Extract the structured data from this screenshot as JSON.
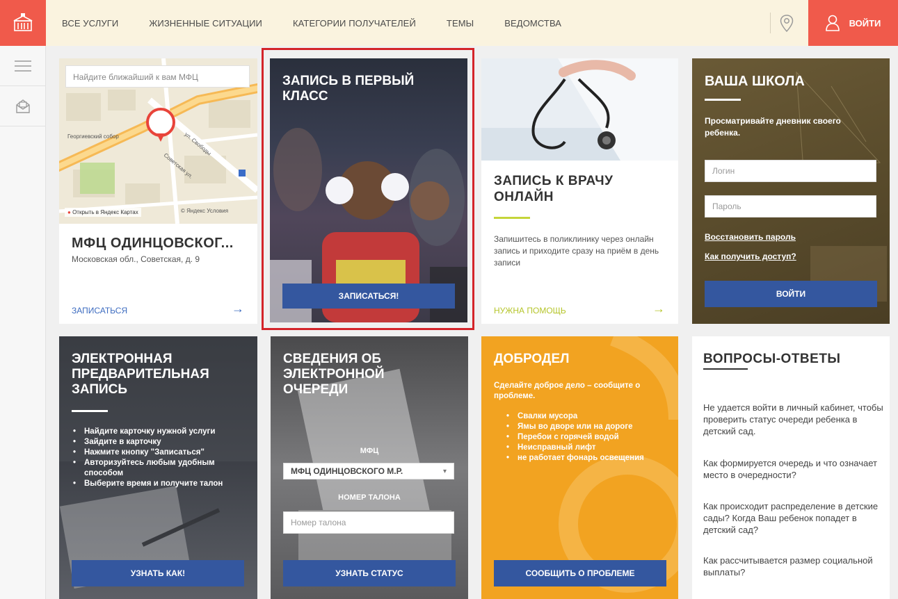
{
  "nav": {
    "items": [
      "ВСЕ УСЛУГИ",
      "ЖИЗНЕННЫЕ СИТУАЦИИ",
      "КАТЕГОРИИ ПОЛУЧАТЕЛЕЙ",
      "ТЕМЫ",
      "ВЕДОМСТВА"
    ],
    "login": "ВОЙТИ"
  },
  "mfc": {
    "search_placeholder": "Найдите ближайший к вам МФЦ",
    "map_open": "Открыть в Яндекс Картах",
    "map_yandex": "© Яндекс Условия",
    "title": "МФЦ ОДИНЦОВСКОГ...",
    "address": "Московская обл., Советская, д. 9",
    "action": "ЗАПИСАТЬСЯ"
  },
  "first_class": {
    "title": "ЗАПИСЬ В ПЕРВЫЙ КЛАСС",
    "button": "ЗАПИСАТЬСЯ!"
  },
  "doctor": {
    "title": "ЗАПИСЬ К ВРАЧУ ОНЛАЙН",
    "text": "Запишитесь в поликлинику через онлайн запись и приходите сразу на приём в день записи",
    "action": "НУЖНА ПОМОЩЬ"
  },
  "school": {
    "title": "ВАША ШКОЛА",
    "text": "Просматривайте дневник своего ребенка.",
    "login_placeholder": "Логин",
    "password_placeholder": "Пароль",
    "restore": "Восстановить пароль",
    "access": "Как получить доступ?",
    "button": "ВОЙТИ"
  },
  "prereg": {
    "title": "ЭЛЕКТРОННАЯ ПРЕДВАРИТЕЛЬНАЯ ЗАПИСЬ",
    "steps": [
      "Найдите карточку нужной услуги",
      "Зайдите в карточку",
      "Нажмите кнопку \"Записаться\"",
      "Авторизуйтесь любым удобным способом",
      "Выберите время и получите талон"
    ],
    "button": "УЗНАТЬ КАК!"
  },
  "queue": {
    "title": "СВЕДЕНИЯ ОБ ЭЛЕКТРОННОЙ ОЧЕРЕДИ",
    "mfc_label": "МФЦ",
    "mfc_selected": "МФЦ ОДИНЦОВСКОГО М.Р.",
    "ticket_label": "НОМЕР ТАЛОНА",
    "ticket_placeholder": "Номер талона",
    "button": "УЗНАТЬ СТАТУС"
  },
  "dobrodel": {
    "title": "ДОБРОДЕЛ",
    "text": "Сделайте доброе дело – сообщите о проблеме.",
    "items": [
      "Свалки мусора",
      "Ямы во дворе или на дороге",
      "Перебои с горячей водой",
      "Неисправный лифт",
      "не работает фонарь освещения"
    ],
    "button": "СООБЩИТЬ О ПРОБЛЕМЕ"
  },
  "faq": {
    "title": "ВОПРОСЫ-ОТВЕТЫ",
    "questions": [
      "Не удается войти в личный кабинет, чтобы проверить статус очереди ребенка в детский сад.",
      "Как формируется очередь и что означает место в очередности?",
      "Как происходит распределение в детские сады? Когда Ваш ребенок попадет в детский сад?",
      "Как рассчитывается размер социальной выплаты?"
    ]
  },
  "colors": {
    "accent_red": "#f05a4b",
    "button_blue": "#34579f",
    "doctor_green": "#c5d53a",
    "dobrodel_orange": "#f2a321"
  }
}
